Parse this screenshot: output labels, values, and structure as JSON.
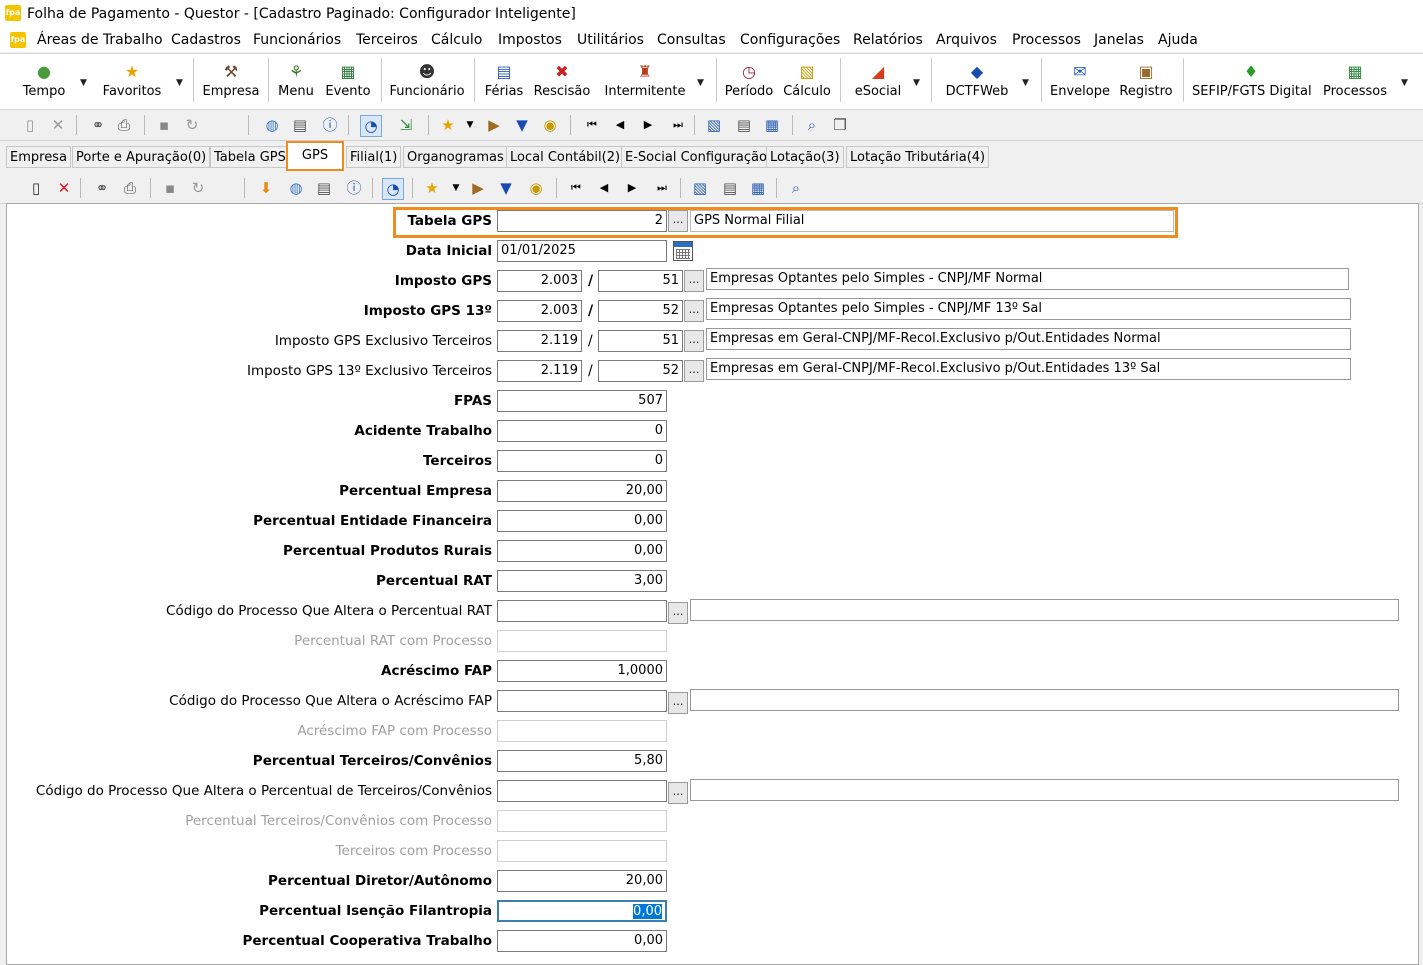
{
  "window": {
    "title": "Folha de Pagamento - Questor - [Cadastro Paginado: Configurador Inteligente]",
    "app_badge": "fpa"
  },
  "menu": [
    "Áreas de Trabalho",
    "Cadastros",
    "Funcionários",
    "Terceiros",
    "Cálculo",
    "Impostos",
    "Utilitários",
    "Consultas",
    "Configurações",
    "Relatórios",
    "Arquivos",
    "Processos",
    "Janelas",
    "Ajuda"
  ],
  "big_toolbar": [
    "Tempo",
    "Favoritos",
    "Empresa",
    "Menu",
    "Evento",
    "Funcionário",
    "Férias",
    "Rescisão",
    "Intermitente",
    "Período",
    "Cálculo",
    "eSocial",
    "DCTFWeb",
    "Envelope",
    "Registro",
    "SEFIP/FGTS Digital",
    "Processos"
  ],
  "tabs": [
    "Empresa",
    "Porte e Apuração(0)",
    "Tabela GPS",
    "GPS",
    "Filial(1)",
    "Organogramas",
    "Local Contábil(2)",
    "E-Social Configuração",
    "Lotação(3)",
    "Lotação Tributária(4)"
  ],
  "form": {
    "tabela_gps": {
      "label": "Tabela GPS",
      "value": "2",
      "desc": "GPS Normal Filial"
    },
    "data_inicial": {
      "label": "Data Inicial",
      "value": "01/01/2025"
    },
    "imposto_gps": {
      "label": "Imposto GPS",
      "code": "2.003",
      "var": "51",
      "desc": "Empresas Optantes pelo Simples - CNPJ/MF Normal"
    },
    "imposto_gps_13": {
      "label": "Imposto GPS 13º",
      "code": "2.003",
      "var": "52",
      "desc": "Empresas Optantes pelo Simples - CNPJ/MF 13º Sal"
    },
    "imposto_excl": {
      "label": "Imposto GPS Exclusivo Terceiros",
      "code": "2.119",
      "var": "51",
      "desc": "Empresas em Geral-CNPJ/MF-Recol.Exclusivo p/Out.Entidades Normal"
    },
    "imposto_excl_13": {
      "label": "Imposto GPS 13º Exclusivo Terceiros",
      "code": "2.119",
      "var": "52",
      "desc": "Empresas em Geral-CNPJ/MF-Recol.Exclusivo p/Out.Entidades 13º Sal"
    },
    "fpas": {
      "label": "FPAS",
      "value": "507"
    },
    "acidente": {
      "label": "Acidente Trabalho",
      "value": "0"
    },
    "terceiros": {
      "label": "Terceiros",
      "value": "0"
    },
    "perc_empresa": {
      "label": "Percentual Empresa",
      "value": "20,00"
    },
    "perc_ent_fin": {
      "label": "Percentual Entidade Financeira",
      "value": "0,00"
    },
    "perc_prod_rurais": {
      "label": "Percentual Produtos Rurais",
      "value": "0,00"
    },
    "perc_rat": {
      "label": "Percentual RAT",
      "value": "3,00"
    },
    "cod_proc_rat": {
      "label": "Código do Processo Que Altera o Percentual RAT",
      "value": ""
    },
    "perc_rat_proc": {
      "label": "Percentual RAT com Processo",
      "value": ""
    },
    "acrescimo_fap": {
      "label": "Acréscimo FAP",
      "value": "1,0000"
    },
    "cod_proc_fap": {
      "label": "Código do Processo Que Altera o Acréscimo FAP",
      "value": ""
    },
    "fap_proc": {
      "label": "Acréscimo FAP com Processo",
      "value": ""
    },
    "perc_terc_conv": {
      "label": "Percentual Terceiros/Convênios",
      "value": "5,80"
    },
    "cod_proc_terc": {
      "label": "Código do Processo Que Altera o Percentual de Terceiros/Convênios",
      "value": ""
    },
    "perc_terc_proc": {
      "label": "Percentual Terceiros/Convênios com Processo",
      "value": ""
    },
    "terc_proc": {
      "label": "Terceiros com Processo",
      "value": ""
    },
    "perc_diretor": {
      "label": "Percentual Diretor/Autônomo",
      "value": "20,00"
    },
    "perc_filantropia": {
      "label": "Percentual Isenção Filantropia",
      "value": "0,00"
    },
    "perc_cooperativa": {
      "label": "Percentual Cooperativa Trabalho",
      "value": "0,00"
    }
  },
  "colors": {
    "highlight": "#f08c1e",
    "selection": "#0078d7"
  }
}
